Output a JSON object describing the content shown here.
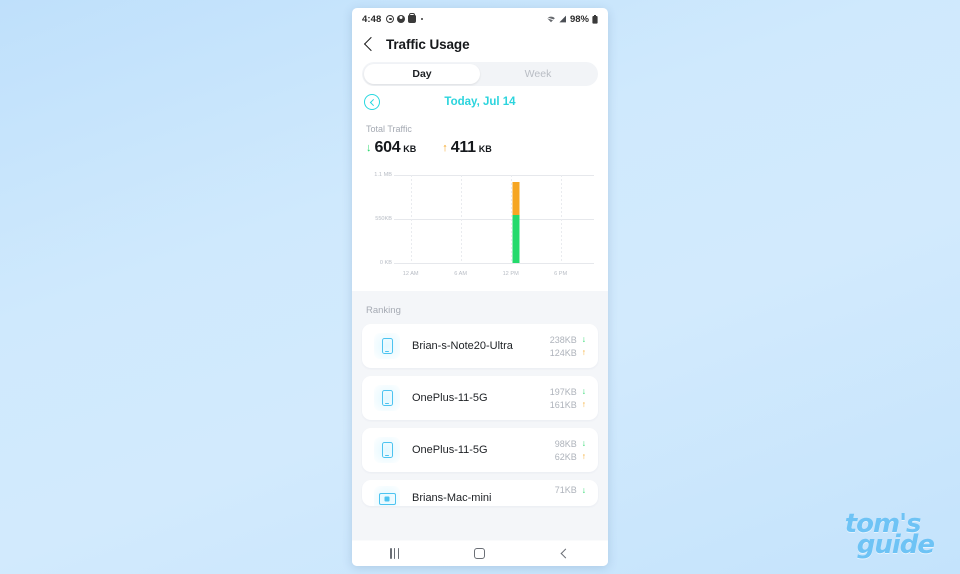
{
  "watermark": {
    "line1": "tom's",
    "line2": "guide",
    "color": "#6ec3f5"
  },
  "statusbar": {
    "time": "4:48",
    "battery_percent": "98%",
    "left_icons": [
      "ring-icon",
      "person-icon",
      "bag-icon",
      "dot-icon"
    ],
    "right_icons": [
      "wifi-icon",
      "signal-icon",
      "battery-icon"
    ]
  },
  "header": {
    "title": "Traffic Usage",
    "back_icon": "chevron-left-icon"
  },
  "tabs": [
    {
      "label": "Day",
      "active": true
    },
    {
      "label": "Week",
      "active": false
    }
  ],
  "date_nav": {
    "prev_icon": "circle-chevron-left-icon",
    "label": "Today, Jul 14"
  },
  "summary": {
    "label": "Total Traffic",
    "download": {
      "arrow": "↓",
      "value": "604",
      "unit": "KB",
      "color": "#1fd665"
    },
    "upload": {
      "arrow": "↑",
      "value": "411",
      "unit": "KB",
      "color": "#f5a623"
    }
  },
  "chart_data": {
    "type": "bar",
    "title": "",
    "xlabel": "",
    "ylabel": "",
    "stacked": true,
    "grid": true,
    "legend": "none",
    "ylim": [
      0,
      1100
    ],
    "ytick_labels": [
      "1.1 MB",
      "550KB",
      "0 KB"
    ],
    "ytick_values": [
      1100,
      550,
      0
    ],
    "x": [
      "12 AM",
      "6 AM",
      "12 PM",
      "6 PM"
    ],
    "xtick_labels": [
      "12 AM",
      "6 AM",
      "12 PM",
      "6 PM"
    ],
    "xtick_hours": [
      0,
      6,
      12,
      18
    ],
    "x_range_hours": [
      -2,
      22
    ],
    "series": [
      {
        "name": "Download",
        "color": "#23da6b",
        "points": [
          {
            "hour": 12.6,
            "value": 604
          }
        ]
      },
      {
        "name": "Upload",
        "color": "#f6a623",
        "points": [
          {
            "hour": 12.6,
            "value": 411
          }
        ]
      }
    ],
    "bars": [
      {
        "hour": 12.6,
        "download": 604,
        "upload": 411,
        "total": 1015
      }
    ]
  },
  "ranking": {
    "label": "Ranking",
    "rows": [
      {
        "icon": "phone-icon",
        "name": "Brian-s-Note20-Ultra",
        "down": "238KB",
        "up": "124KB",
        "clipped": false
      },
      {
        "icon": "phone-icon",
        "name": "OnePlus-11-5G",
        "down": "197KB",
        "up": "161KB",
        "clipped": false
      },
      {
        "icon": "phone-icon",
        "name": "OnePlus-11-5G",
        "down": "98KB",
        "up": "62KB",
        "clipped": false
      },
      {
        "icon": "monitor-icon",
        "name": "Brians-Mac-mini",
        "down": "71KB",
        "up": "",
        "clipped": true
      }
    ],
    "down_arrow": "↓",
    "up_arrow": "↑"
  },
  "navbar": {
    "recents": "recents-icon",
    "home": "home-icon",
    "back": "back-icon"
  }
}
